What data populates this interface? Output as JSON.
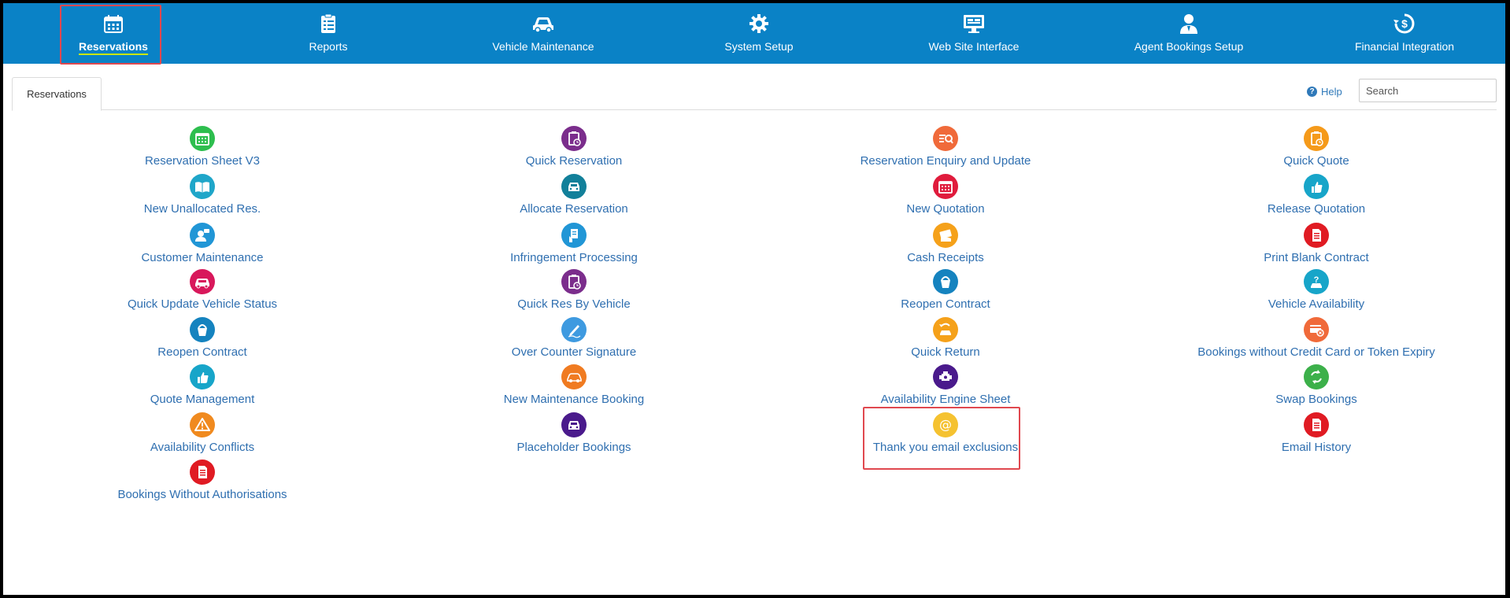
{
  "nav": {
    "items": [
      {
        "label": "Reservations",
        "icon": "calendar-icon"
      },
      {
        "label": "Reports",
        "icon": "checklist-icon"
      },
      {
        "label": "Vehicle Maintenance",
        "icon": "car-icon"
      },
      {
        "label": "System Setup",
        "icon": "gear-icon"
      },
      {
        "label": "Web Site Interface",
        "icon": "monitor-icon"
      },
      {
        "label": "Agent Bookings Setup",
        "icon": "agent-icon"
      },
      {
        "label": "Financial Integration",
        "icon": "dollar-cycle-icon"
      }
    ],
    "active": "Reservations"
  },
  "tabs": [
    {
      "label": "Reservations"
    }
  ],
  "help_label": "Help",
  "search_placeholder": "Search",
  "colors": {
    "nav_bg": "#0a82c6",
    "link": "#2f6fb0",
    "highlight": "#e0484f"
  },
  "columns": [
    [
      {
        "label": "Reservation Sheet V3",
        "icon": "calendar-grid-icon",
        "color": "#2dbe4e"
      },
      {
        "label": "New Unallocated Res.",
        "icon": "book-icon",
        "color": "#1fa6c9"
      },
      {
        "label": "Customer Maintenance",
        "icon": "customer-icon",
        "color": "#2196d6"
      },
      {
        "label": "Quick Update Vehicle Status",
        "icon": "car-icon",
        "color": "#d8185b"
      },
      {
        "label": "Reopen Contract",
        "icon": "bucket-icon",
        "color": "#1583bf"
      },
      {
        "label": "Quote Management",
        "icon": "thumbs-up-icon",
        "color": "#17a5c9"
      },
      {
        "label": "Availability Conflicts",
        "icon": "warning-icon",
        "color": "#f08a1f"
      },
      {
        "label": "Bookings Without Authorisations",
        "icon": "document-icon",
        "color": "#e01b23"
      }
    ],
    [
      {
        "label": "Quick Reservation",
        "icon": "clipboard-clock-icon",
        "color": "#7b2d8c"
      },
      {
        "label": "Allocate Reservation",
        "icon": "car-front-icon",
        "color": "#12809a"
      },
      {
        "label": "Infringement Processing",
        "icon": "document-hand-icon",
        "color": "#2196d6"
      },
      {
        "label": "Quick Res By Vehicle",
        "icon": "clipboard-clock-icon",
        "color": "#7b2d8c"
      },
      {
        "label": "Over Counter Signature",
        "icon": "pen-icon",
        "color": "#3e9ae0"
      },
      {
        "label": "New Maintenance Booking",
        "icon": "car-outline-icon",
        "color": "#f07b21"
      },
      {
        "label": "Placeholder Bookings",
        "icon": "car-front-icon",
        "color": "#4a1a8c"
      }
    ],
    [
      {
        "label": "Reservation Enquiry and Update",
        "icon": "search-list-icon",
        "color": "#f06a3a"
      },
      {
        "label": "New Quotation",
        "icon": "calendar-grid-icon",
        "color": "#e01b3c"
      },
      {
        "label": "Cash Receipts",
        "icon": "cash-icon",
        "color": "#f5a11a"
      },
      {
        "label": "Reopen Contract",
        "icon": "bucket-icon",
        "color": "#1583bf"
      },
      {
        "label": "Quick Return",
        "icon": "car-return-icon",
        "color": "#f5a11a"
      },
      {
        "label": "Availability Engine Sheet",
        "icon": "engine-icon",
        "color": "#4a1a8c"
      },
      {
        "label": "Thank you email exclusions",
        "icon": "at-icon",
        "color": "#f5c230"
      }
    ],
    [
      {
        "label": "Quick Quote",
        "icon": "clipboard-clock-icon",
        "color": "#f59a1a"
      },
      {
        "label": "Release Quotation",
        "icon": "thumbs-up-icon",
        "color": "#17a5c9"
      },
      {
        "label": "Print Blank Contract",
        "icon": "document-icon",
        "color": "#e01b23"
      },
      {
        "label": "Vehicle Availability",
        "icon": "question-car-icon",
        "color": "#17a5c9"
      },
      {
        "label": "Bookings without Credit Card or Token Expiry",
        "icon": "card-x-icon",
        "color": "#f06a3a"
      },
      {
        "label": "Swap Bookings",
        "icon": "swap-icon",
        "color": "#3cb04a"
      },
      {
        "label": "Email History",
        "icon": "document-icon",
        "color": "#e01b23"
      }
    ]
  ]
}
